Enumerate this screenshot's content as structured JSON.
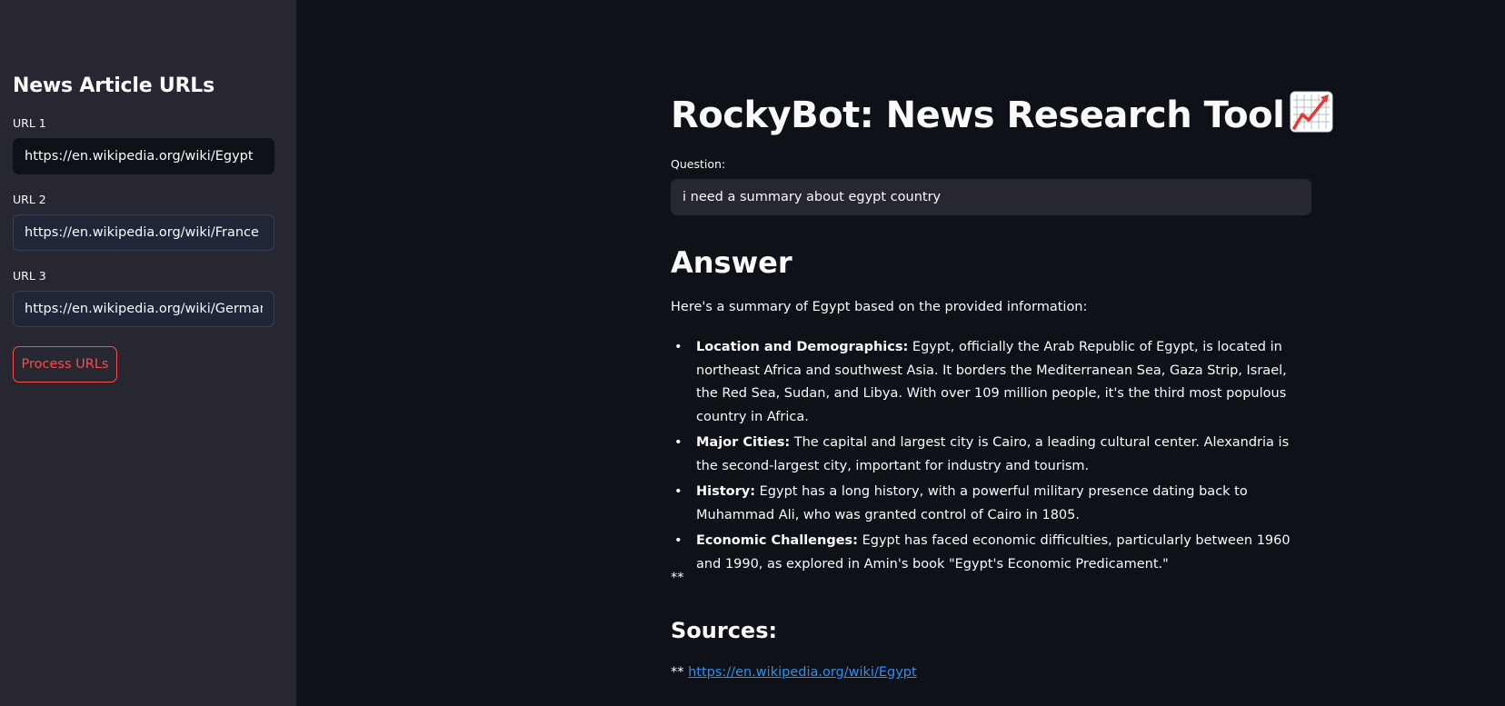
{
  "sidebar": {
    "title": "News Article URLs",
    "urls": [
      {
        "label": "URL 1",
        "value": "https://en.wikipedia.org/wiki/Egypt"
      },
      {
        "label": "URL 2",
        "value": "https://en.wikipedia.org/wiki/France"
      },
      {
        "label": "URL 3",
        "value": "https://en.wikipedia.org/wiki/Germany"
      }
    ],
    "process_button": "Process URLs"
  },
  "main": {
    "title": "RockyBot: News Research Tool",
    "title_icon": "chart-increasing-icon",
    "question_label": "Question:",
    "question_value": "i need a summary about egypt country",
    "answer_heading": "Answer",
    "answer_intro": "Here's a summary of Egypt based on the provided information:",
    "bullets": [
      {
        "term": "Location and Demographics:",
        "text": " Egypt, officially the Arab Republic of Egypt, is located in northeast Africa and southwest Asia. It borders the Mediterranean Sea, Gaza Strip, Israel, the Red Sea, Sudan, and Libya. With over 109 million people, it's the third most populous country in Africa."
      },
      {
        "term": "Major Cities:",
        "text": " The capital and largest city is Cairo, a leading cultural center. Alexandria is the second-largest city, important for industry and tourism."
      },
      {
        "term": "History:",
        "text": " Egypt has a long history, with a powerful military presence dating back to Muhammad Ali, who was granted control of Cairo in 1805."
      },
      {
        "term": "Economic Challenges:",
        "text": " Egypt has faced economic difficulties, particularly between 1960 and 1990, as explored in Amin's book \"Egypt's Economic Predicament.\""
      }
    ],
    "stars": "**",
    "sources_heading": "Sources:",
    "source_prefix": "** ",
    "source_link": "https://en.wikipedia.org/wiki/Egypt"
  },
  "colors": {
    "background": "#0e1117",
    "sidebar": "#262730",
    "accent": "#ff4b4b",
    "link": "#2f8ff0"
  }
}
